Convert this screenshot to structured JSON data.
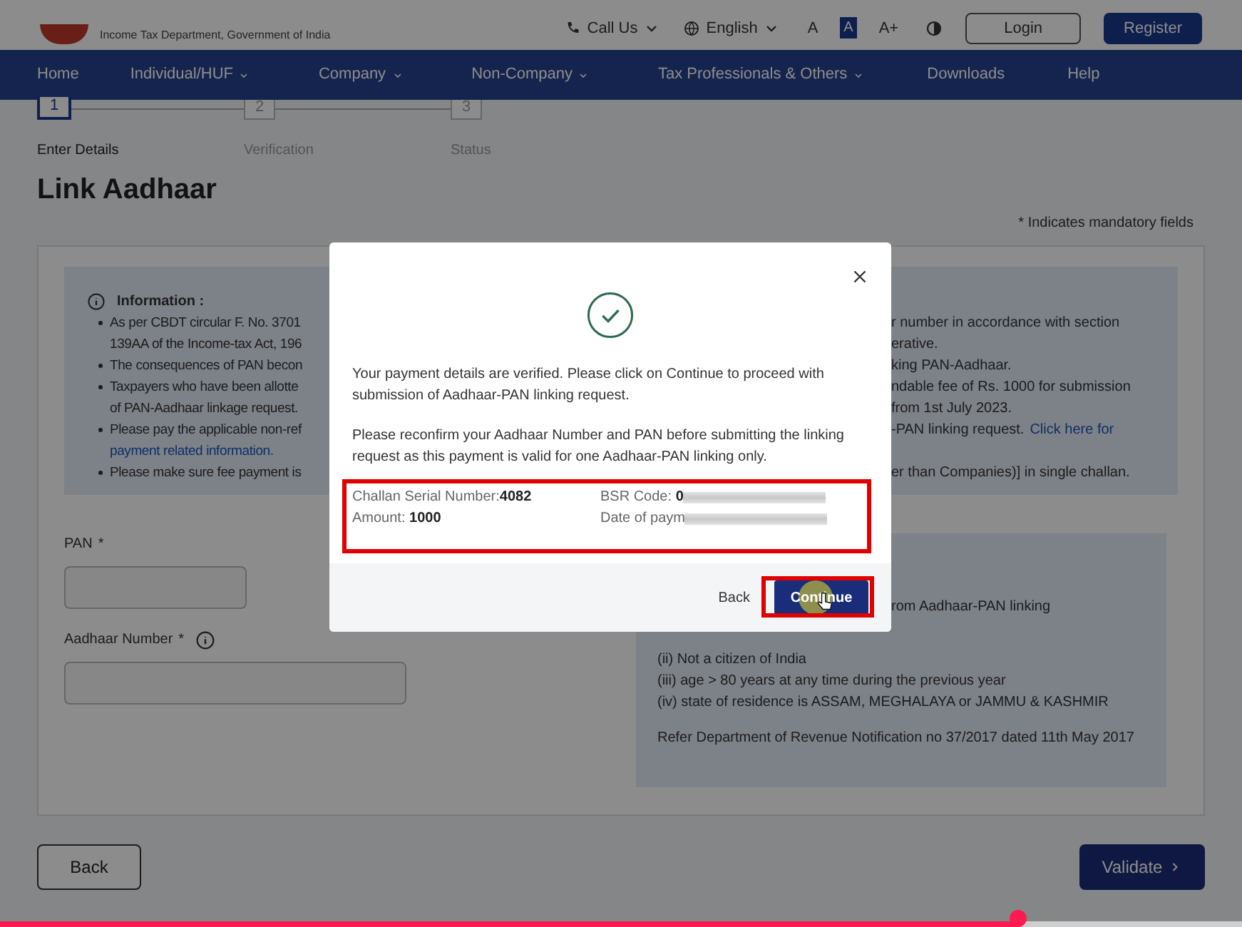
{
  "header": {
    "department": "Income Tax Department, Government of India",
    "call_us": "Call Us",
    "language": "English",
    "font_sizes": [
      "A",
      "A",
      "A+"
    ],
    "font_size_selected": [
      false,
      true,
      false
    ],
    "login": "Login",
    "register": "Register"
  },
  "nav": {
    "items": [
      {
        "label": "Home",
        "dropdown": false
      },
      {
        "label": "Individual/HUF",
        "dropdown": true
      },
      {
        "label": "Company",
        "dropdown": true
      },
      {
        "label": "Non-Company",
        "dropdown": true
      },
      {
        "label": "Tax Professionals & Others",
        "dropdown": true
      },
      {
        "label": "Downloads",
        "dropdown": false
      },
      {
        "label": "Help",
        "dropdown": false
      }
    ]
  },
  "steps": [
    {
      "number": "1",
      "label": "Enter Details",
      "selected": true
    },
    {
      "number": "2",
      "label": "Verification",
      "selected": false
    },
    {
      "number": "3",
      "label": "Status",
      "selected": false
    }
  ],
  "page_title": "Link Aadhaar",
  "mandatory_note": "* Indicates mandatory fields",
  "info": {
    "heading": "Information :",
    "left_lines": [
      {
        "text": "As per CBDT circular F. No. 3701",
        "bullet": true,
        "link": false
      },
      {
        "text": "139AA of the Income-tax Act, 196",
        "bullet": false,
        "link": false
      },
      {
        "text": "The consequences of PAN becon",
        "bullet": true,
        "link": false
      },
      {
        "text": "Taxpayers who have been allotte",
        "bullet": true,
        "link": false
      },
      {
        "text": "of PAN-Aadhaar linkage request.",
        "bullet": false,
        "link": false
      },
      {
        "text": "Please pay the applicable non-ref",
        "bullet": true,
        "link": false
      },
      {
        "text": "payment related information.",
        "bullet": false,
        "link": true
      },
      {
        "text": "Please make sure fee payment is",
        "bullet": true,
        "link": false
      }
    ],
    "right_lines": [
      {
        "text": "r number in accordance with section"
      },
      {
        "text": "erative."
      },
      {
        "text": "king PAN-Aadhaar."
      },
      {
        "text": "ndable fee of Rs. 1000 for submission"
      },
      {
        "text": "from 1st July 2023."
      },
      {
        "text": "-PAN linking request.",
        "link": "Click here for"
      }
    ],
    "right_last_line": "er than Companies)] in single challan."
  },
  "form": {
    "fields": [
      {
        "label": "PAN",
        "required_mark": "*",
        "info": false,
        "kind": "short"
      },
      {
        "label": "Aadhaar Number",
        "required_mark": "*",
        "info": true,
        "kind": "long"
      }
    ]
  },
  "exemptions": {
    "lines": [
      "rom Aadhaar-PAN linking",
      "(ii) Not a citizen of India",
      "(iii) age > 80 years at any time during the previous year",
      "(iv) state of residence is ASSAM, MEGHALAYA or JAMMU & KASHMIR"
    ],
    "note": "Refer Department of Revenue Notification no 37/2017 dated 11th May 2017"
  },
  "buttons": {
    "back": "Back",
    "validate": "Validate"
  },
  "modal": {
    "message": "Your payment details are verified. Please click on Continue to proceed with submission of Aadhaar-PAN linking request.",
    "reconfirm": "Please reconfirm your Aadhaar Number and PAN before submitting the linking request as this payment is valid for one Aadhaar-PAN linking only.",
    "details": [
      {
        "label": "Challan Serial Number:",
        "value": "4082",
        "redacted": false
      },
      {
        "label": "BSR Code: ",
        "value": "0",
        "redacted": true
      },
      {
        "label": "Amount: ",
        "value": "1000",
        "redacted": false
      },
      {
        "label": "Date of paym",
        "redacted": true
      }
    ],
    "back": "Back",
    "continue": "Continue"
  },
  "video": {
    "level": 0.82
  }
}
